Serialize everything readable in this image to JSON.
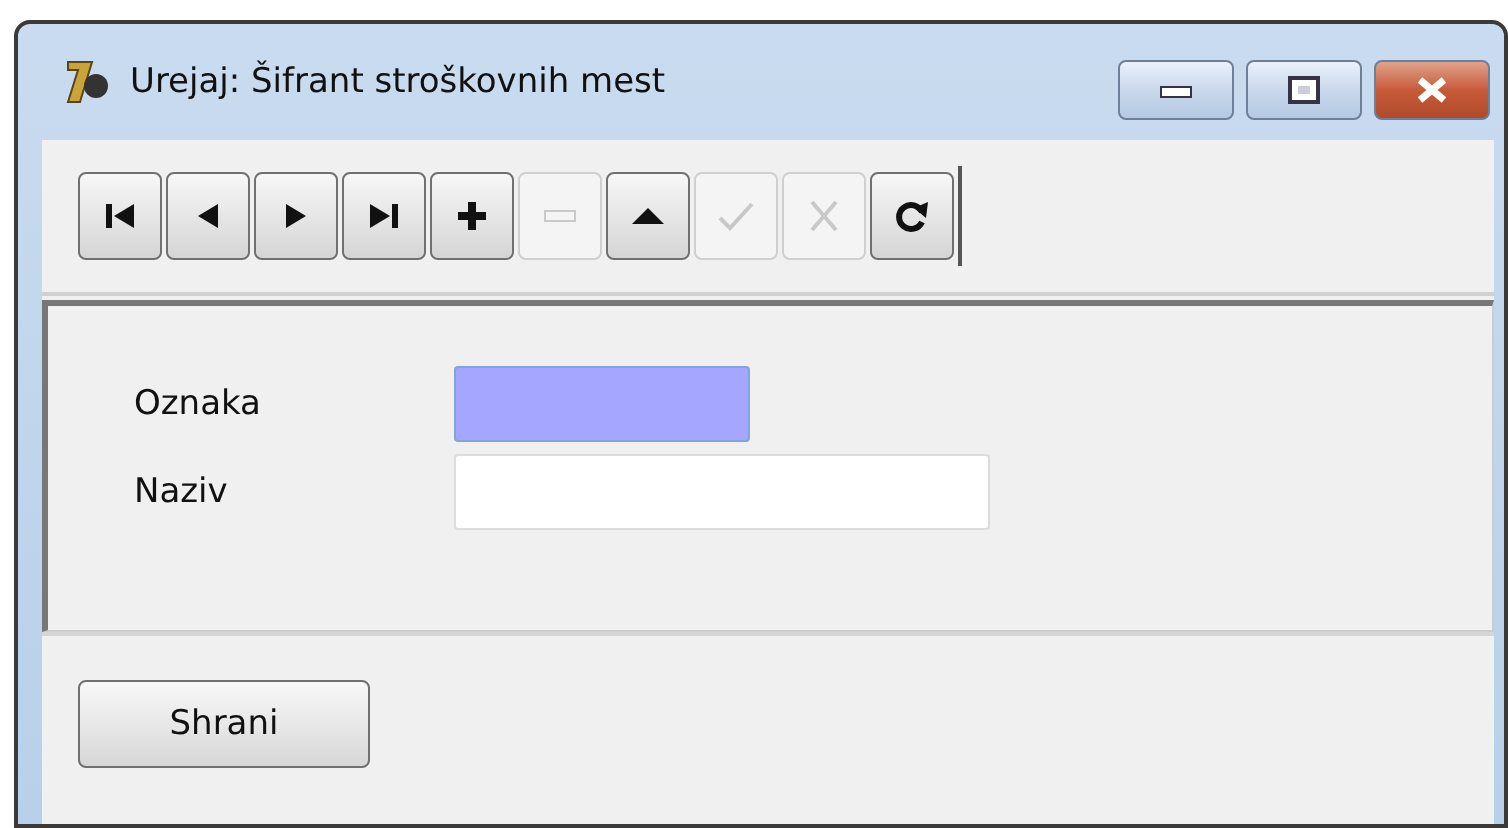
{
  "window": {
    "title": "Urejaj: Šifrant stroškovnih mest"
  },
  "toolbar": [
    {
      "kind": "first",
      "disabled": false
    },
    {
      "kind": "prev",
      "disabled": false
    },
    {
      "kind": "next",
      "disabled": false
    },
    {
      "kind": "last",
      "disabled": false
    },
    {
      "kind": "add",
      "disabled": false
    },
    {
      "kind": "delete",
      "disabled": true
    },
    {
      "kind": "up",
      "disabled": false
    },
    {
      "kind": "confirm",
      "disabled": true
    },
    {
      "kind": "cancel",
      "disabled": true
    },
    {
      "kind": "refresh",
      "disabled": false
    }
  ],
  "fields": [
    {
      "label": "Oznaka",
      "focused": true,
      "wide": false
    },
    {
      "label": "Naziv",
      "focused": false,
      "wide": true
    }
  ],
  "buttons": [
    "Shrani"
  ]
}
